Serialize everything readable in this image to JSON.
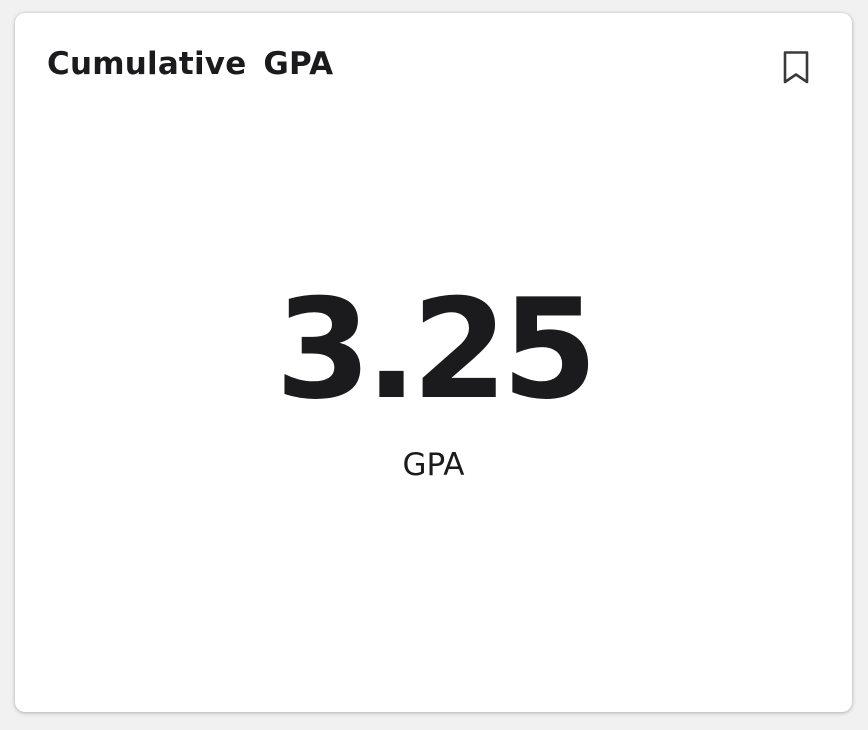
{
  "card": {
    "title": "Cumulative  GPA",
    "bookmark_icon": "bookmark-outline-icon",
    "value": "3.25",
    "unit": "GPA"
  },
  "colors": {
    "text": "#1b1b1d",
    "card_background": "#ffffff",
    "page_background": "#f1f1f1",
    "icon": "#3a3a3c"
  }
}
